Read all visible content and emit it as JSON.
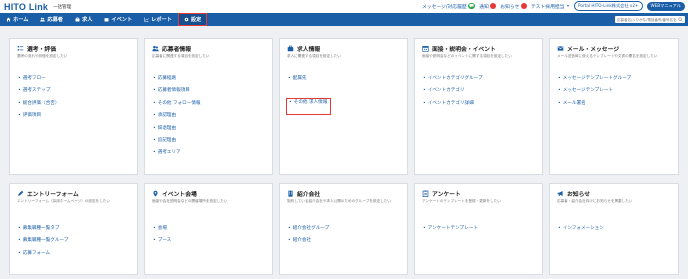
{
  "header": {
    "logo": "HITO Link",
    "app_name": "一括管理",
    "links": {
      "messages": "メッセージ/対応履歴",
      "messages_badge": "",
      "notices": "通知",
      "notices_badge": "",
      "info": "お知らせ",
      "info_badge": "",
      "user": "テスト採用担当",
      "portal": "Portal HITO-Link株式会社 v2+",
      "manual": "WEBマニュアル"
    }
  },
  "nav": {
    "items": [
      {
        "label": "ホーム",
        "icon": "home-icon"
      },
      {
        "label": "応募者",
        "icon": "users-icon"
      },
      {
        "label": "求人",
        "icon": "briefcase-icon"
      },
      {
        "label": "イベント",
        "icon": "calendar-icon"
      },
      {
        "label": "レポート",
        "icon": "chart-icon"
      },
      {
        "label": "設定",
        "icon": "gear-icon"
      }
    ],
    "search_placeholder": "応募者名/ふりがな/電話番号/番号名を検索"
  },
  "cards": [
    {
      "title": "選考・評価",
      "icon": "list-check-icon",
      "desc": "選考の流れや評価を設定したい",
      "items": [
        "選考フロー",
        "選考ステップ",
        "総合評価（合否）",
        "評価項目"
      ]
    },
    {
      "title": "応募者情報",
      "icon": "users-icon",
      "desc": "応募者に関連する項目を設定したい",
      "items": [
        "応募経路",
        "応募者情報項目",
        "その他 フォロー情報",
        "承認理由",
        "辞退理由",
        "追記理由",
        "選考エリア"
      ]
    },
    {
      "title": "求人情報",
      "icon": "briefcase-icon",
      "desc": "求人に関連する項目を設定したい",
      "items": [
        "配属先",
        "その他 求人情報"
      ]
    },
    {
      "title": "面接・説明会・イベント",
      "icon": "calendar-icon",
      "desc": "面接や説明会などのイベントに関する項目を設定したい",
      "items": [
        "イベントカテゴリグループ",
        "イベントカテゴリ",
        "イベントカテゴリ詳細"
      ]
    },
    {
      "title": "メール・メッセージ",
      "icon": "envelope-icon",
      "desc": "メール送信時に使えるテンプレートや文書の署名を設定したい",
      "items": [
        "メッセージテンプレートグループ",
        "メッセージテンプレート",
        "メール署名"
      ]
    },
    {
      "title": "エントリーフォーム",
      "icon": "pencil-icon",
      "desc": "エントリーフォーム（採用ホームページ）の設定をしたい",
      "items": [
        "募集職種一覧タブ",
        "募集職種一覧グループ",
        "応募フォーム"
      ]
    },
    {
      "title": "イベント会場",
      "icon": "map-pin-icon",
      "desc": "面接や会社説明会などの開催場所を設定したい",
      "items": [
        "会場",
        "ブース"
      ]
    },
    {
      "title": "紹介会社",
      "icon": "building-icon",
      "desc": "契約している紹介会社や求人公開のためのグループを設定したい",
      "items": [
        "紹介会社グループ",
        "紹介会社"
      ]
    },
    {
      "title": "アンケート",
      "icon": "clipboard-icon",
      "desc": "アンケートのテンプレートを登録・更新をしたい",
      "items": [
        "アンケートテンプレート"
      ]
    },
    {
      "title": "お知らせ",
      "icon": "megaphone-icon",
      "desc": "応募者・紹介会社向けにお知らせを掲載したい",
      "items": [
        "インフォメーション"
      ]
    }
  ],
  "colors": {
    "primary": "#1b5ea8",
    "highlight": "#e53935",
    "background": "#eef0f3"
  }
}
